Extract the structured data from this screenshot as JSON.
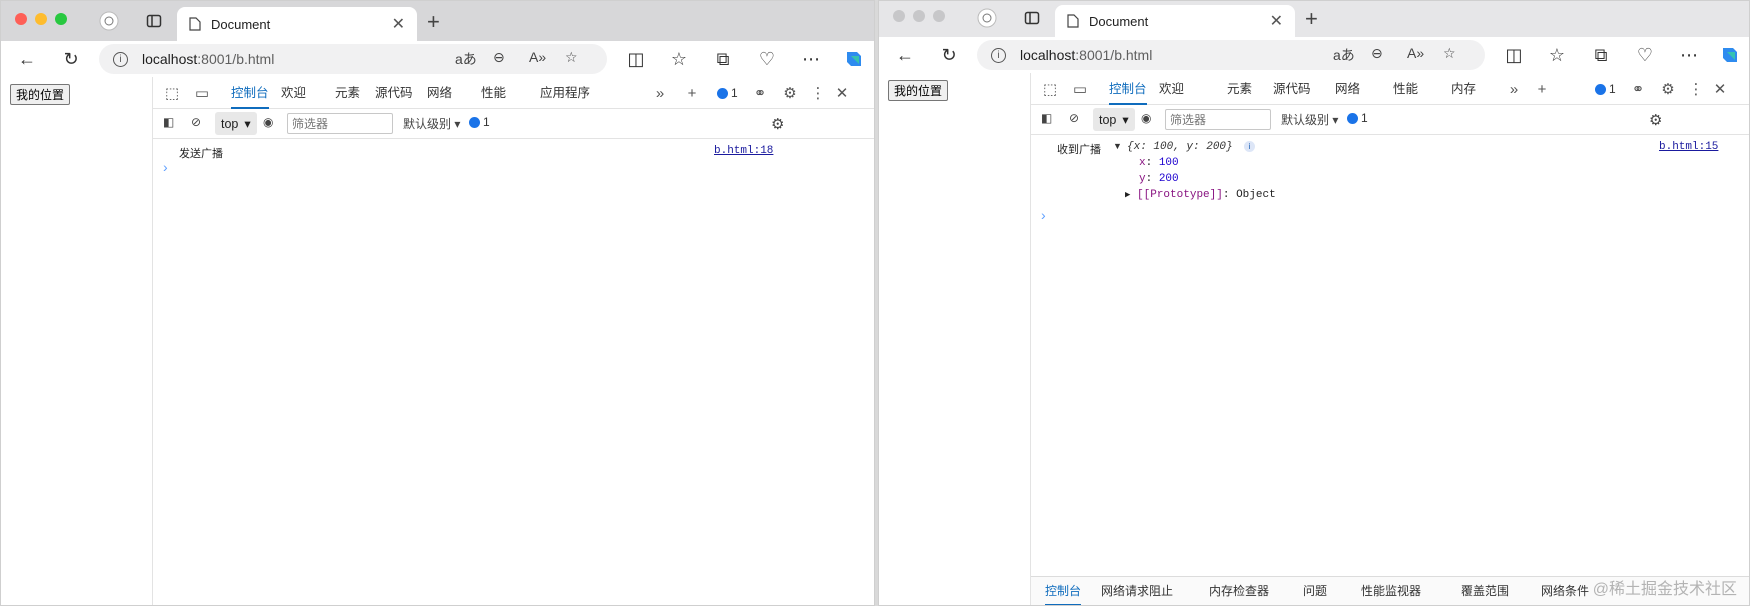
{
  "left_window": {
    "tab_title": "Document",
    "url_host": "localhost",
    "url_path": ":8001/b.html",
    "page_button": "我的位置",
    "devtools_tabs": [
      "控制台",
      "欢迎",
      "元素",
      "源代码",
      "网络",
      "性能",
      "应用程序"
    ],
    "issue_count": "1",
    "context": "top",
    "filter_placeholder": "筛选器",
    "level_label": "默认级别",
    "msg_count": "1",
    "log_text": "发送广播",
    "log_source": "b.html:18"
  },
  "right_window": {
    "tab_title": "Document",
    "url_host": "localhost",
    "url_path": ":8001/b.html",
    "page_button": "我的位置",
    "devtools_tabs": [
      "控制台",
      "欢迎",
      "元素",
      "源代码",
      "网络",
      "性能",
      "内存"
    ],
    "issue_count": "1",
    "context": "top",
    "filter_placeholder": "筛选器",
    "level_label": "默认级别",
    "msg_count": "1",
    "log_label": "收到广播",
    "log_object_summary": "{x: 100, y: 200}",
    "log_source": "b.html:15",
    "prop_x_key": "x",
    "prop_x_val": "100",
    "prop_y_key": "y",
    "prop_y_val": "200",
    "proto_key": "[[Prototype]]",
    "proto_val": "Object",
    "drawer_tabs": [
      "控制台",
      "网络请求阻止",
      "内存检查器",
      "问题",
      "性能监视器",
      "覆盖范围",
      "网络条件"
    ]
  },
  "watermark": "@稀土掘金技术社区",
  "colors": {
    "accent": "#0f6cbd",
    "close_red": "#fe5f57",
    "minimize_yellow": "#febc2e",
    "zoom_green": "#28c840"
  }
}
